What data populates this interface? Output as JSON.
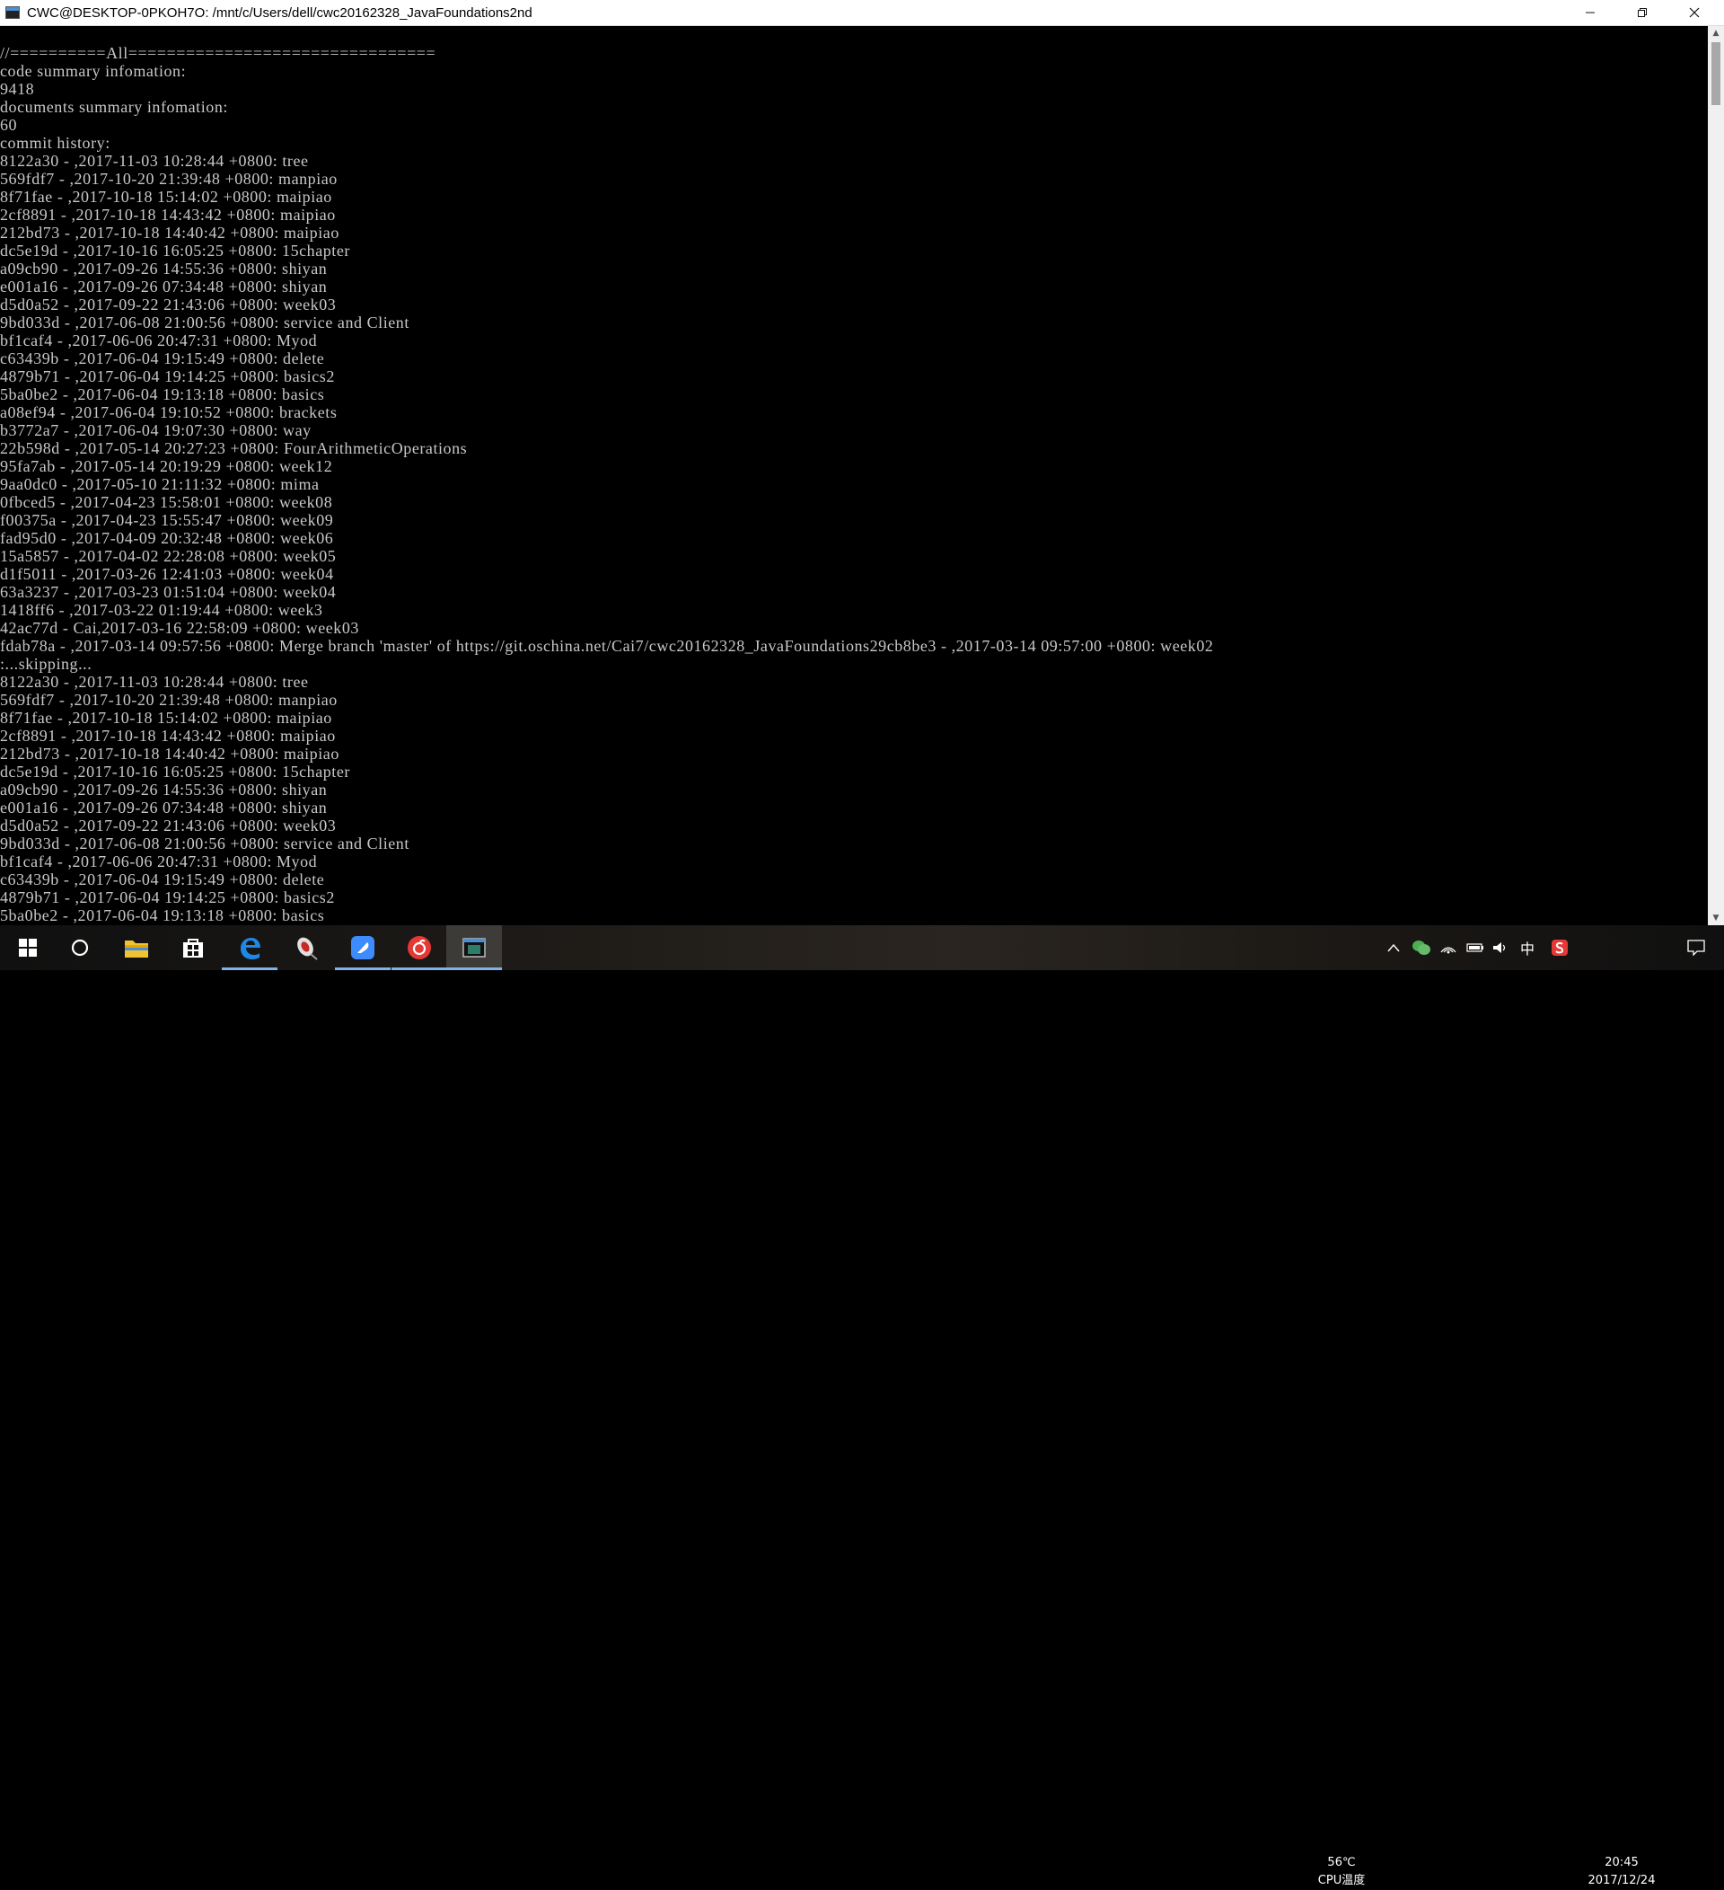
{
  "window": {
    "title": "CWC@DESKTOP-0PKOH7O: /mnt/c/Users/dell/cwc20162328_JavaFoundations2nd",
    "minimize_glyph": "─",
    "maximize_glyph": "❐",
    "close_glyph": "✕"
  },
  "terminal": {
    "lines": [
      "//==========All================================",
      "code summary infomation:",
      "9418",
      "documents summary infomation:",
      "60",
      "commit history:",
      "8122a30 - ,2017-11-03 10:28:44 +0800: tree",
      "569fdf7 - ,2017-10-20 21:39:48 +0800: manpiao",
      "8f71fae - ,2017-10-18 15:14:02 +0800: maipiao",
      "2cf8891 - ,2017-10-18 14:43:42 +0800: maipiao",
      "212bd73 - ,2017-10-18 14:40:42 +0800: maipiao",
      "dc5e19d - ,2017-10-16 16:05:25 +0800: 15chapter",
      "a09cb90 - ,2017-09-26 14:55:36 +0800: shiyan",
      "e001a16 - ,2017-09-26 07:34:48 +0800: shiyan",
      "d5d0a52 - ,2017-09-22 21:43:06 +0800: week03",
      "9bd033d - ,2017-06-08 21:00:56 +0800: service and Client",
      "bf1caf4 - ,2017-06-06 20:47:31 +0800: Myod",
      "c63439b - ,2017-06-04 19:15:49 +0800: delete",
      "4879b71 - ,2017-06-04 19:14:25 +0800: basics2",
      "5ba0be2 - ,2017-06-04 19:13:18 +0800: basics",
      "a08ef94 - ,2017-06-04 19:10:52 +0800: brackets",
      "b3772a7 - ,2017-06-04 19:07:30 +0800: way",
      "22b598d - ,2017-05-14 20:27:23 +0800: FourArithmeticOperations",
      "95fa7ab - ,2017-05-14 20:19:29 +0800: week12",
      "9aa0dc0 - ,2017-05-10 21:11:32 +0800: mima",
      "0fbced5 - ,2017-04-23 15:58:01 +0800: week08",
      "f00375a - ,2017-04-23 15:55:47 +0800: week09",
      "fad95d0 - ,2017-04-09 20:32:48 +0800: week06",
      "15a5857 - ,2017-04-02 22:28:08 +0800: week05",
      "d1f5011 - ,2017-03-26 12:41:03 +0800: week04",
      "63a3237 - ,2017-03-23 01:51:04 +0800: week04",
      "1418ff6 - ,2017-03-22 01:19:44 +0800: week3",
      "42ac77d - Cai,2017-03-16 22:58:09 +0800: week03",
      "fdab78a - ,2017-03-14 09:57:56 +0800: Merge branch 'master' of https://git.oschina.net/Cai7/cwc20162328_JavaFoundations29cb8be3 - ,2017-03-14 09:57:00 +0800: week02",
      ":...skipping...",
      "8122a30 - ,2017-11-03 10:28:44 +0800: tree",
      "569fdf7 - ,2017-10-20 21:39:48 +0800: manpiao",
      "8f71fae - ,2017-10-18 15:14:02 +0800: maipiao",
      "2cf8891 - ,2017-10-18 14:43:42 +0800: maipiao",
      "212bd73 - ,2017-10-18 14:40:42 +0800: maipiao",
      "dc5e19d - ,2017-10-16 16:05:25 +0800: 15chapter",
      "a09cb90 - ,2017-09-26 14:55:36 +0800: shiyan",
      "e001a16 - ,2017-09-26 07:34:48 +0800: shiyan",
      "d5d0a52 - ,2017-09-22 21:43:06 +0800: week03",
      "9bd033d - ,2017-06-08 21:00:56 +0800: service and Client",
      "bf1caf4 - ,2017-06-06 20:47:31 +0800: Myod",
      "c63439b - ,2017-06-04 19:15:49 +0800: delete",
      "4879b71 - ,2017-06-04 19:14:25 +0800: basics2",
      "5ba0be2 - ,2017-06-04 19:13:18 +0800: basics"
    ]
  },
  "taskbar": {
    "pinned": [
      {
        "name": "start-button",
        "icon": "windows-logo-icon",
        "active": false,
        "current": false
      },
      {
        "name": "cortana-button",
        "icon": "cortana-circle-icon",
        "active": false,
        "current": false
      },
      {
        "name": "file-explorer-button",
        "icon": "folder-icon",
        "active": false,
        "current": false
      },
      {
        "name": "store-button",
        "icon": "store-bag-icon",
        "active": false,
        "current": false
      },
      {
        "name": "edge-button",
        "icon": "edge-icon",
        "active": true,
        "current": false
      },
      {
        "name": "app-mouse-button",
        "icon": "mouse-app-icon",
        "active": false,
        "current": false
      },
      {
        "name": "feather-app-button",
        "icon": "feather-app-icon",
        "active": true,
        "current": false
      },
      {
        "name": "netease-music-button",
        "icon": "music-app-icon",
        "active": true,
        "current": false
      },
      {
        "name": "terminal-app-button",
        "icon": "terminal-window-icon",
        "active": true,
        "current": true
      }
    ],
    "temperature": "56℃",
    "temperature_label": "CPU温度",
    "ime_label": "中",
    "time": "20:45",
    "date": "2017/12/24"
  },
  "colors": {
    "terminal_bg": "#000000",
    "terminal_fg": "#c8c8c8",
    "titlebar_bg": "#ffffff",
    "taskbar_active_indicator": "#7fb2e5"
  }
}
